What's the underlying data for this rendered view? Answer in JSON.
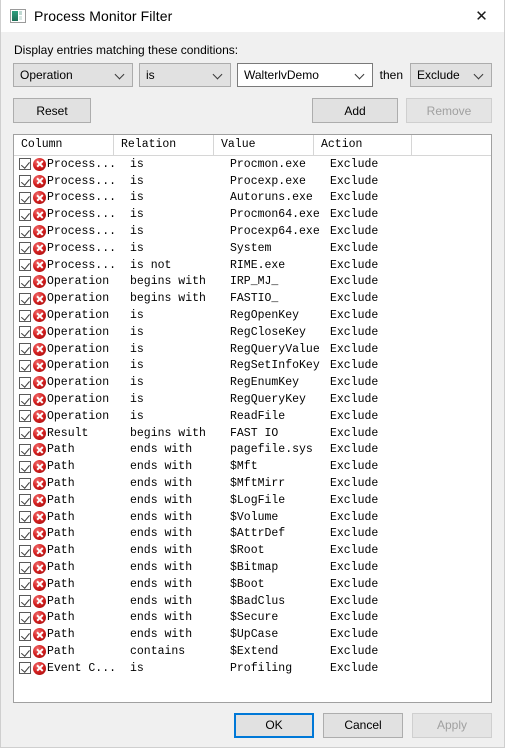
{
  "window": {
    "title": "Process Monitor Filter",
    "app_icon": "procmon-icon",
    "close_label": "✕"
  },
  "filter": {
    "prompt": "Display entries matching these conditions:",
    "column_value": "Operation",
    "relation_value": "is",
    "value_value": "WalterlvDemo",
    "value_placeholder": "",
    "then_label": "then",
    "action_value": "Exclude"
  },
  "buttons": {
    "reset": "Reset",
    "add": "Add",
    "remove": "Remove",
    "ok": "OK",
    "cancel": "Cancel",
    "apply": "Apply"
  },
  "list": {
    "headers": [
      "Column",
      "Relation",
      "Value",
      "Action",
      ""
    ],
    "rows": [
      {
        "checked": true,
        "column": "Process...",
        "relation": "is",
        "value": "Procmon.exe",
        "action": "Exclude"
      },
      {
        "checked": true,
        "column": "Process...",
        "relation": "is",
        "value": "Procexp.exe",
        "action": "Exclude"
      },
      {
        "checked": true,
        "column": "Process...",
        "relation": "is",
        "value": "Autoruns.exe",
        "action": "Exclude"
      },
      {
        "checked": true,
        "column": "Process...",
        "relation": "is",
        "value": "Procmon64.exe",
        "action": "Exclude"
      },
      {
        "checked": true,
        "column": "Process...",
        "relation": "is",
        "value": "Procexp64.exe",
        "action": "Exclude"
      },
      {
        "checked": true,
        "column": "Process...",
        "relation": "is",
        "value": "System",
        "action": "Exclude"
      },
      {
        "checked": true,
        "column": "Process...",
        "relation": "is not",
        "value": "RIME.exe",
        "action": "Exclude"
      },
      {
        "checked": true,
        "column": "Operation",
        "relation": "begins with",
        "value": "IRP_MJ_",
        "action": "Exclude"
      },
      {
        "checked": true,
        "column": "Operation",
        "relation": "begins with",
        "value": "FASTIO_",
        "action": "Exclude"
      },
      {
        "checked": true,
        "column": "Operation",
        "relation": "is",
        "value": "RegOpenKey",
        "action": "Exclude"
      },
      {
        "checked": true,
        "column": "Operation",
        "relation": "is",
        "value": "RegCloseKey",
        "action": "Exclude"
      },
      {
        "checked": true,
        "column": "Operation",
        "relation": "is",
        "value": "RegQueryValue",
        "action": "Exclude"
      },
      {
        "checked": true,
        "column": "Operation",
        "relation": "is",
        "value": "RegSetInfoKey",
        "action": "Exclude"
      },
      {
        "checked": true,
        "column": "Operation",
        "relation": "is",
        "value": "RegEnumKey",
        "action": "Exclude"
      },
      {
        "checked": true,
        "column": "Operation",
        "relation": "is",
        "value": "RegQueryKey",
        "action": "Exclude"
      },
      {
        "checked": true,
        "column": "Operation",
        "relation": "is",
        "value": "ReadFile",
        "action": "Exclude"
      },
      {
        "checked": true,
        "column": "Result",
        "relation": "begins with",
        "value": "FAST IO",
        "action": "Exclude"
      },
      {
        "checked": true,
        "column": "Path",
        "relation": "ends with",
        "value": "pagefile.sys",
        "action": "Exclude"
      },
      {
        "checked": true,
        "column": "Path",
        "relation": "ends with",
        "value": "$Mft",
        "action": "Exclude"
      },
      {
        "checked": true,
        "column": "Path",
        "relation": "ends with",
        "value": "$MftMirr",
        "action": "Exclude"
      },
      {
        "checked": true,
        "column": "Path",
        "relation": "ends with",
        "value": "$LogFile",
        "action": "Exclude"
      },
      {
        "checked": true,
        "column": "Path",
        "relation": "ends with",
        "value": "$Volume",
        "action": "Exclude"
      },
      {
        "checked": true,
        "column": "Path",
        "relation": "ends with",
        "value": "$AttrDef",
        "action": "Exclude"
      },
      {
        "checked": true,
        "column": "Path",
        "relation": "ends with",
        "value": "$Root",
        "action": "Exclude"
      },
      {
        "checked": true,
        "column": "Path",
        "relation": "ends with",
        "value": "$Bitmap",
        "action": "Exclude"
      },
      {
        "checked": true,
        "column": "Path",
        "relation": "ends with",
        "value": "$Boot",
        "action": "Exclude"
      },
      {
        "checked": true,
        "column": "Path",
        "relation": "ends with",
        "value": "$BadClus",
        "action": "Exclude"
      },
      {
        "checked": true,
        "column": "Path",
        "relation": "ends with",
        "value": "$Secure",
        "action": "Exclude"
      },
      {
        "checked": true,
        "column": "Path",
        "relation": "ends with",
        "value": "$UpCase",
        "action": "Exclude"
      },
      {
        "checked": true,
        "column": "Path",
        "relation": "contains",
        "value": "$Extend",
        "action": "Exclude"
      },
      {
        "checked": true,
        "column": "Event C...",
        "relation": "is",
        "value": "Profiling",
        "action": "Exclude"
      }
    ]
  },
  "colors": {
    "accent": "#0078d7",
    "exclude_icon": "#d32020",
    "dialog_bg": "#f0f0f0"
  }
}
